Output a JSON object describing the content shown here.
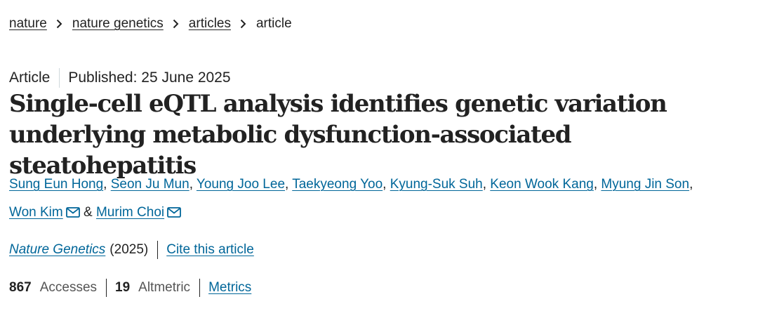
{
  "breadcrumb": {
    "items": [
      {
        "label": "nature"
      },
      {
        "label": "nature genetics"
      },
      {
        "label": "articles"
      }
    ],
    "current": "article"
  },
  "article": {
    "type": "Article",
    "published": "Published: 25 June 2025",
    "title": "Single-cell eQTL analysis identifies genetic variation underlying metabolic dysfunction-associated steatohepatitis"
  },
  "authors": [
    {
      "name": "Sung Eun Hong"
    },
    {
      "name": "Seon Ju Mun"
    },
    {
      "name": "Young Joo Lee"
    },
    {
      "name": "Taekyeong Yoo"
    },
    {
      "name": "Kyung-Suk Suh"
    },
    {
      "name": "Keon Wook Kang"
    },
    {
      "name": "Myung Jin Son"
    },
    {
      "name": "Won Kim",
      "icon": "mail-icon"
    },
    {
      "name": "Murim Choi",
      "icon": "mail-icon"
    }
  ],
  "author_separator": ",",
  "author_conjunction": "&",
  "citation": {
    "journal": "Nature Genetics",
    "year": "(2025)",
    "cite_link": "Cite this article"
  },
  "metrics": {
    "accesses_count": "867",
    "accesses_label": "Accesses",
    "altmetric_count": "19",
    "altmetric_label": "Altmetric",
    "metrics_link": "Metrics"
  },
  "colors": {
    "link": "#006699",
    "text": "#222222",
    "divider": "#cfd8dc"
  }
}
